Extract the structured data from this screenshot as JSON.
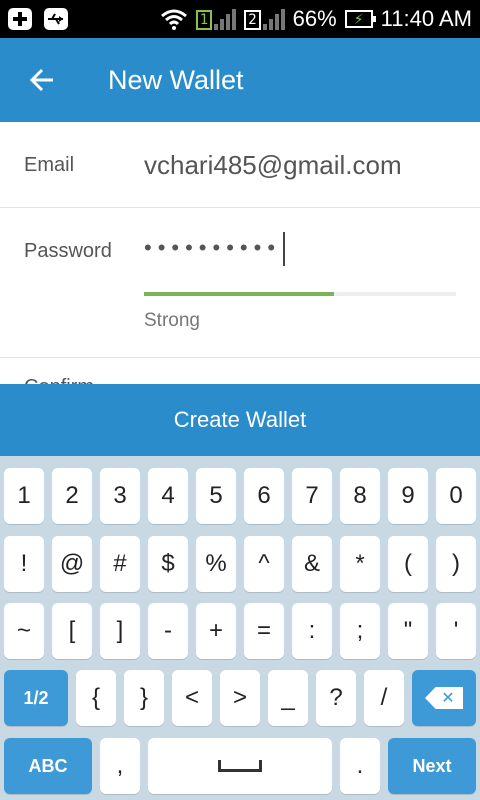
{
  "status_bar": {
    "sim1": "1",
    "sim2": "2",
    "battery": "66%",
    "time": "11:40 AM",
    "icons": [
      "plus-notification-icon",
      "usb-icon",
      "wifi-icon",
      "sim1-signal-icon",
      "sim2-signal-icon",
      "battery-charging-icon"
    ]
  },
  "app_bar": {
    "back_icon": "arrow-left-icon",
    "title": "New Wallet"
  },
  "form": {
    "email_label": "Email",
    "email_value": "vchari485@gmail.com",
    "password_label": "Password",
    "password_mask": "••••••••••",
    "password_strength_label": "Strong",
    "password_strength": 0.61,
    "strength_color": "#7cb35a",
    "confirm_label": "Confirm"
  },
  "create_button": "Create Wallet",
  "keyboard": {
    "row1": [
      "1",
      "2",
      "3",
      "4",
      "5",
      "6",
      "7",
      "8",
      "9",
      "0"
    ],
    "row2": [
      "!",
      "@",
      "#",
      "$",
      "%",
      "^",
      "&",
      "*",
      "(",
      ")"
    ],
    "row3": [
      "~",
      "[",
      "]",
      "-",
      "+",
      "=",
      ":",
      ";",
      "\"",
      "'"
    ],
    "row4": {
      "shift": "1/2",
      "keys": [
        "{",
        "}",
        "<",
        ">",
        "_",
        "?",
        "/"
      ],
      "backspace_icon": "backspace-icon"
    },
    "row5": {
      "abc": "ABC",
      "comma": ",",
      "space_icon": "space-icon",
      "period": ".",
      "next": "Next"
    }
  },
  "colors": {
    "primary": "#2b8ccc",
    "keyboard_bg": "#c8d9e3",
    "accent_key": "#3d9ad6"
  }
}
